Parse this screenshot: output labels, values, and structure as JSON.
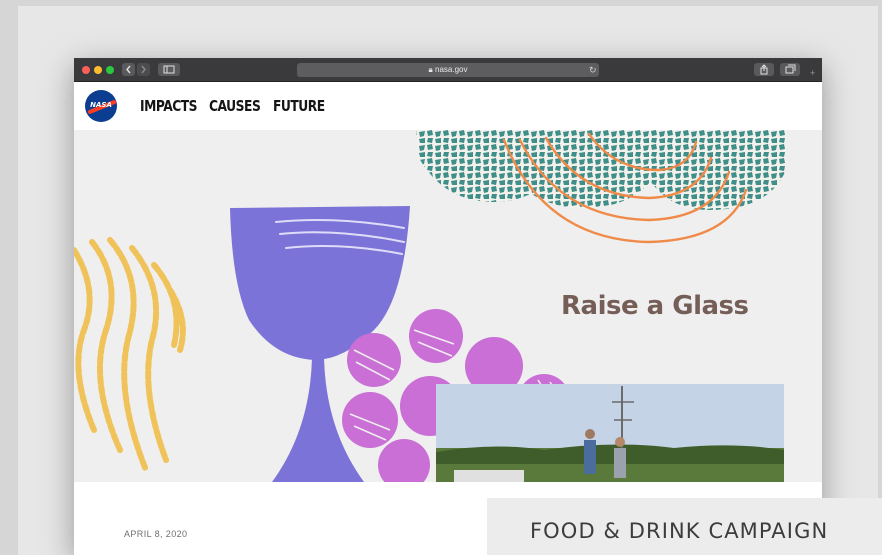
{
  "browser": {
    "url": "nasa.gov",
    "back_icon": "chevron-left-icon",
    "forward_icon": "chevron-right-icon",
    "sidebar_icon": "sidebar-icon",
    "reload_icon": "reload-icon",
    "share_icon": "share-icon",
    "tabs_icon": "tabs-icon",
    "new_tab_icon": "plus-icon"
  },
  "nav": {
    "logo_text": "NASA",
    "items": [
      "IMPACTS",
      "CAUSES",
      "FUTURE"
    ]
  },
  "hero": {
    "title": "Raise a Glass"
  },
  "article": {
    "date": "APRIL 8, 2020"
  },
  "tag": {
    "label": "FOOD & DRINK CAMPAIGN"
  },
  "colors": {
    "goblet": "#7c73d8",
    "grapes": "#c96fd6",
    "mosaic": "#3f8e89",
    "accent_orange": "#f08a48",
    "wheat_yellow": "#f0c25a",
    "title_brown": "#765e58",
    "nasa_blue": "#0b3d91",
    "nasa_red": "#fc3d21"
  }
}
